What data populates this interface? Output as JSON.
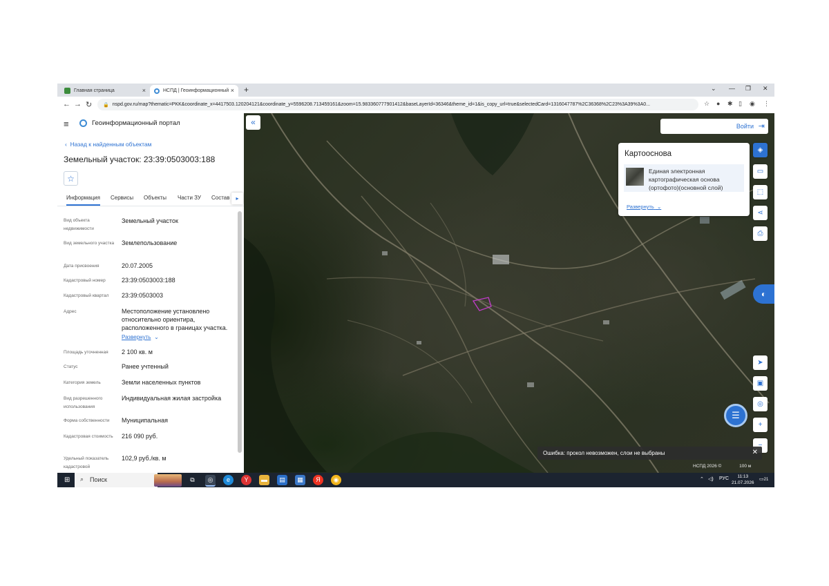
{
  "browser": {
    "tabs": [
      {
        "title": "Главная страница",
        "active": false
      },
      {
        "title": "НСПД | Геоинформационный",
        "active": true
      }
    ],
    "url": "nspd.gov.ru/map?thematic=PKK&coordinate_x=4417503.120204121&coordinate_y=5596208.713459161&zoom=15.983360777901412&baseLayerId=36346&theme_id=1&is_copy_url=true&selectedCard=1316047787%2C36368%2C23%3A39%3A0..."
  },
  "panel": {
    "portal_name": "Геоинформационный портал",
    "back_link": "Назад к найденным объектам",
    "title": "Земельный участок: 23:39:0503003:188",
    "tabs": [
      "Информация",
      "Сервисы",
      "Объекты",
      "Части ЗУ",
      "Состав"
    ],
    "attributes": [
      {
        "label": "Вид объекта недвижимости",
        "value": "Земельный участок"
      },
      {
        "label": "Вид земельного участка",
        "value": "Землепользование"
      },
      {
        "label": "Дата присвоения",
        "value": "20.07.2005"
      },
      {
        "label": "Кадастровый номер",
        "value": "23:39:0503003:188"
      },
      {
        "label": "Кадастровый квартал",
        "value": "23:39:0503003"
      },
      {
        "label": "Адрес",
        "value": "Местоположение установлено относительно ориентира, расположенного в границах участка."
      },
      {
        "label": "Площадь уточненная",
        "value": "2 100 кв. м"
      },
      {
        "label": "Статус",
        "value": "Ранее учтенный"
      },
      {
        "label": "Категория земель",
        "value": "Земли населенных пунктов"
      },
      {
        "label": "Вид разрешенного использования",
        "value": "Индивидуальная жилая застройка"
      },
      {
        "label": "Форма собственности",
        "value": "Муниципальная"
      },
      {
        "label": "Кадастровая стоимость",
        "value": "216 090 руб."
      },
      {
        "label": "Удельный показатель кадастровой",
        "value": "102,9 руб./кв. м"
      }
    ],
    "expand_label": "Развернуть"
  },
  "map": {
    "login_label": "Войти",
    "layer_panel": {
      "title": "Картооснова",
      "item": "Единая электронная картографическая основа (ортофото)(основной слой)",
      "expand_label": "Развернуть"
    },
    "error_message": "Ошибка: прокол невозможен, слои не выбраны",
    "footer": "НСПД 2026 ©",
    "scale": "100 м"
  },
  "taskbar": {
    "search_label": "Поиск",
    "language": "РУС",
    "time": "11:13",
    "date": "21.07.2026",
    "notifications": "21"
  },
  "colors": {
    "accent": "#2d72d2",
    "parcel": "#c03cc8"
  }
}
